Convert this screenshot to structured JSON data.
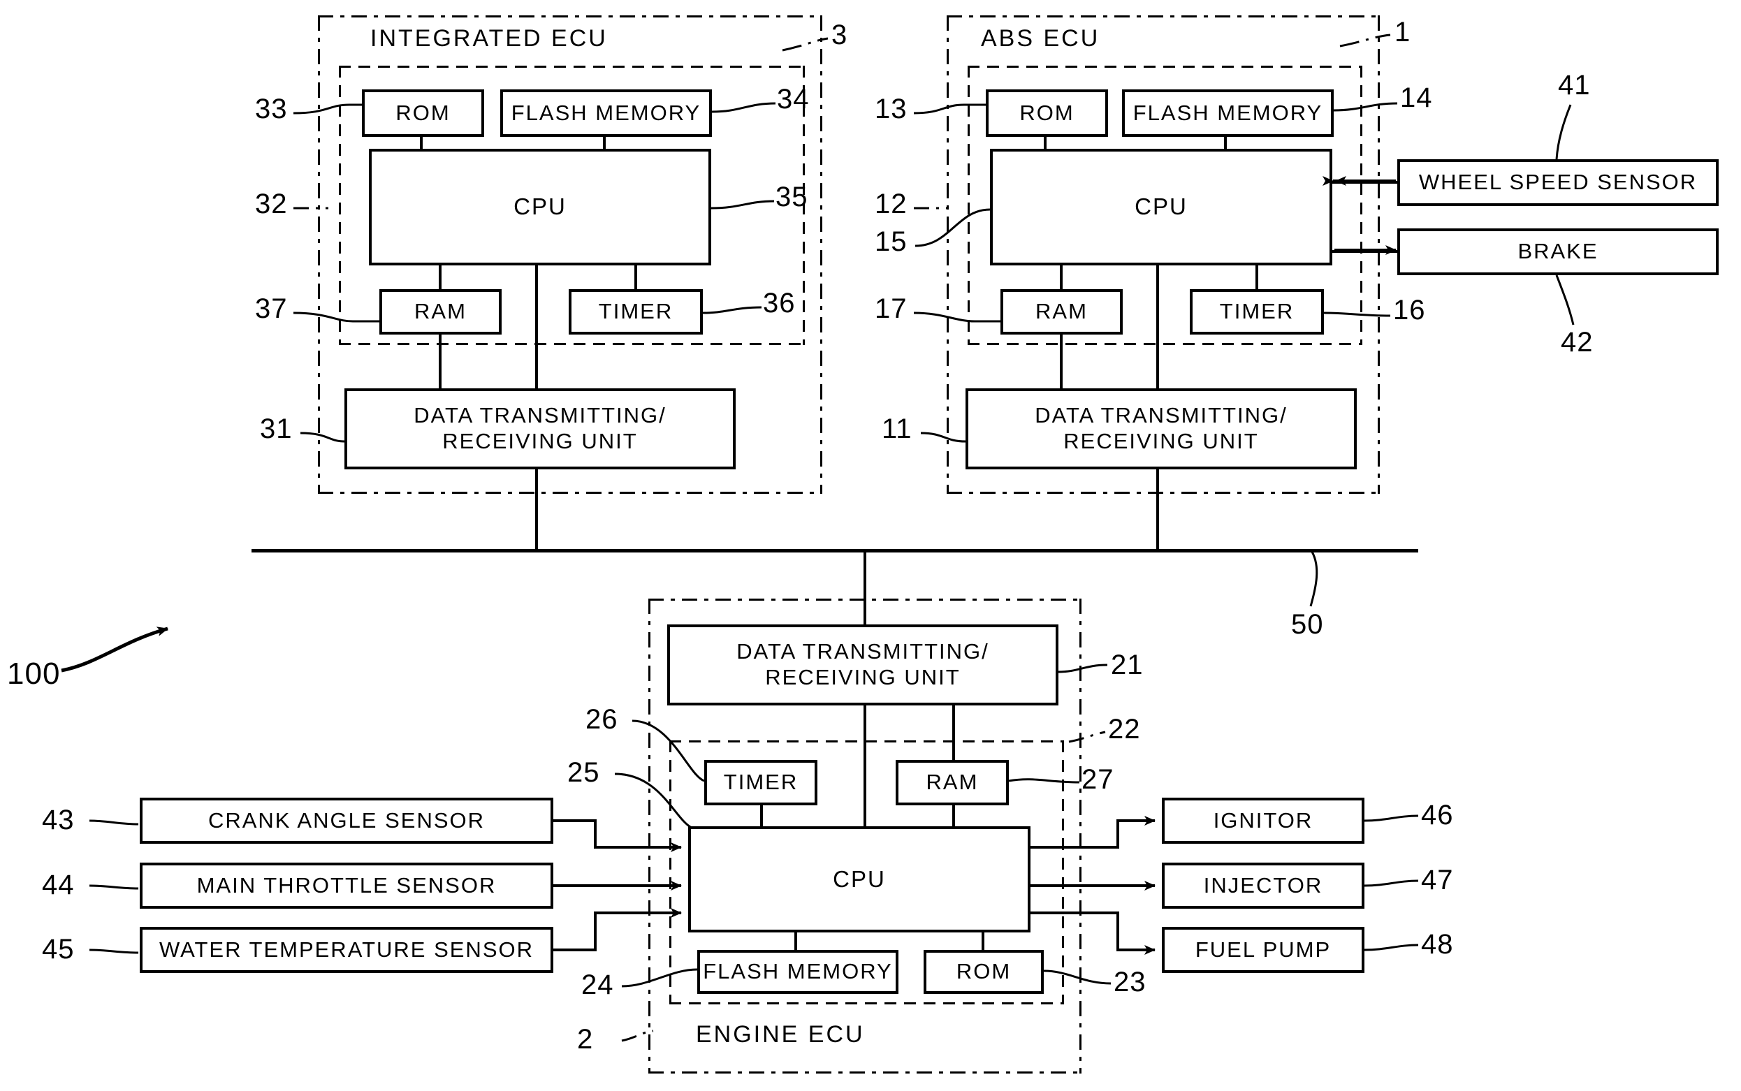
{
  "figure": {
    "system_ref": "100",
    "bus_ref": "50"
  },
  "integrated_ecu": {
    "title": "INTEGRATED ECU",
    "ref": "3",
    "core_ref": "32",
    "blocks": {
      "rom": {
        "label": "ROM",
        "ref": "33"
      },
      "flash": {
        "label": "FLASH MEMORY",
        "ref": "34"
      },
      "cpu": {
        "label": "CPU",
        "ref": "35"
      },
      "ram": {
        "label": "RAM",
        "ref": "37"
      },
      "timer": {
        "label": "TIMER",
        "ref": "36"
      },
      "comm": {
        "label_line1": "DATA TRANSMITTING/",
        "label_line2": "RECEIVING UNIT",
        "ref": "31"
      }
    }
  },
  "abs_ecu": {
    "title": "ABS ECU",
    "ref": "1",
    "core_ref": "12",
    "blocks": {
      "rom": {
        "label": "ROM",
        "ref": "13"
      },
      "flash": {
        "label": "FLASH MEMORY",
        "ref": "14"
      },
      "cpu": {
        "label": "CPU",
        "ref": "15"
      },
      "ram": {
        "label": "RAM",
        "ref": "17"
      },
      "timer": {
        "label": "TIMER",
        "ref": "16"
      },
      "comm": {
        "label_line1": "DATA TRANSMITTING/",
        "label_line2": "RECEIVING UNIT",
        "ref": "11"
      }
    }
  },
  "engine_ecu": {
    "title": "ENGINE ECU",
    "ref": "2",
    "core_ref": "22",
    "blocks": {
      "comm": {
        "label_line1": "DATA TRANSMITTING/",
        "label_line2": "RECEIVING UNIT",
        "ref": "21"
      },
      "timer": {
        "label": "TIMER",
        "ref": "26"
      },
      "ram": {
        "label": "RAM",
        "ref": "27"
      },
      "cpu": {
        "label": "CPU",
        "ref": "25"
      },
      "flash": {
        "label": "FLASH MEMORY",
        "ref": "24"
      },
      "rom": {
        "label": "ROM",
        "ref": "23"
      }
    }
  },
  "abs_peripherals": [
    {
      "label": "WHEEL SPEED SENSOR",
      "ref": "41",
      "direction": "input"
    },
    {
      "label": "BRAKE",
      "ref": "42",
      "direction": "output"
    }
  ],
  "engine_inputs": [
    {
      "label": "CRANK ANGLE SENSOR",
      "ref": "43"
    },
    {
      "label": "MAIN THROTTLE SENSOR",
      "ref": "44"
    },
    {
      "label": "WATER TEMPERATURE SENSOR",
      "ref": "45"
    }
  ],
  "engine_outputs": [
    {
      "label": "IGNITOR",
      "ref": "46"
    },
    {
      "label": "INJECTOR",
      "ref": "47"
    },
    {
      "label": "FUEL PUMP",
      "ref": "48"
    }
  ],
  "colors": {
    "ink": "#000000",
    "paper": "#ffffff"
  }
}
